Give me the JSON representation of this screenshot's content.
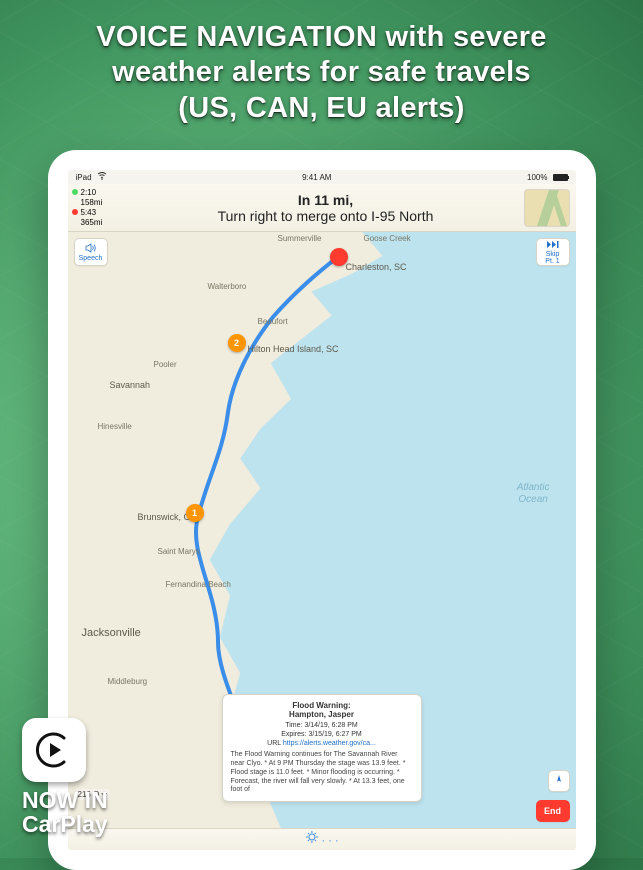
{
  "headline": {
    "line1": "VOICE NAVIGATION with severe",
    "line2": "weather alerts for safe travels",
    "line3": "(US, CAN, EU alerts)"
  },
  "statusbar": {
    "device": "iPad",
    "time": "9:41 AM",
    "battery": "100%"
  },
  "eta": {
    "green_time": "2:10",
    "green_dist": "158mi",
    "red_time": "5:43",
    "red_dist": "365mi"
  },
  "instruction": {
    "line1": "In 11 mi,",
    "line2": "Turn right to merge onto I-95 North"
  },
  "mapButtons": {
    "speech": "Speech",
    "skip_label": "Skip",
    "skip_sub": "Pt. 1",
    "end": "End"
  },
  "oceanLabel": {
    "line1": "Atlantic",
    "line2": "Ocean"
  },
  "cities": {
    "summerville": "Summerville",
    "goosecreek": "Goose Creek",
    "charleston": "Charleston, SC",
    "walterboro": "Walterboro",
    "beaufort": "Beaufort",
    "hiltonhead": "Hilton Head Island, SC",
    "pooler": "Pooler",
    "savannah": "Savannah",
    "hinesville": "Hinesville",
    "brunswick": "Brunswick, GA",
    "fernandina": "Fernandina Beach",
    "jacksonville": "Jacksonville",
    "middleburg": "Middleburg",
    "saintmarys": "Saint Marys"
  },
  "waypoints": {
    "wp1": "1",
    "wp2": "2",
    "dest": ""
  },
  "currentDist": "216 O",
  "alert": {
    "title1": "Flood Warning:",
    "title2": "Hampton, Jasper",
    "time_label": "Time:",
    "time_value": "3/14/19, 6:28 PM",
    "expires_label": "Expires:",
    "expires_value": "3/15/19, 6:27 PM",
    "url_label": "URL",
    "url_value": "https://alerts.weather.gov/ca...",
    "body": "The Flood Warning continues for The Savannah River near Clyo. * At 9 PM Thursday the stage was 13.9 feet. * Flood stage is 11.0 feet. * Minor flooding is occurring. * Forecast, the river will fall very slowly. * At 13.3 feet, one foot of"
  },
  "carplay": {
    "line1": "NOW IN",
    "line2": "CarPlay"
  }
}
